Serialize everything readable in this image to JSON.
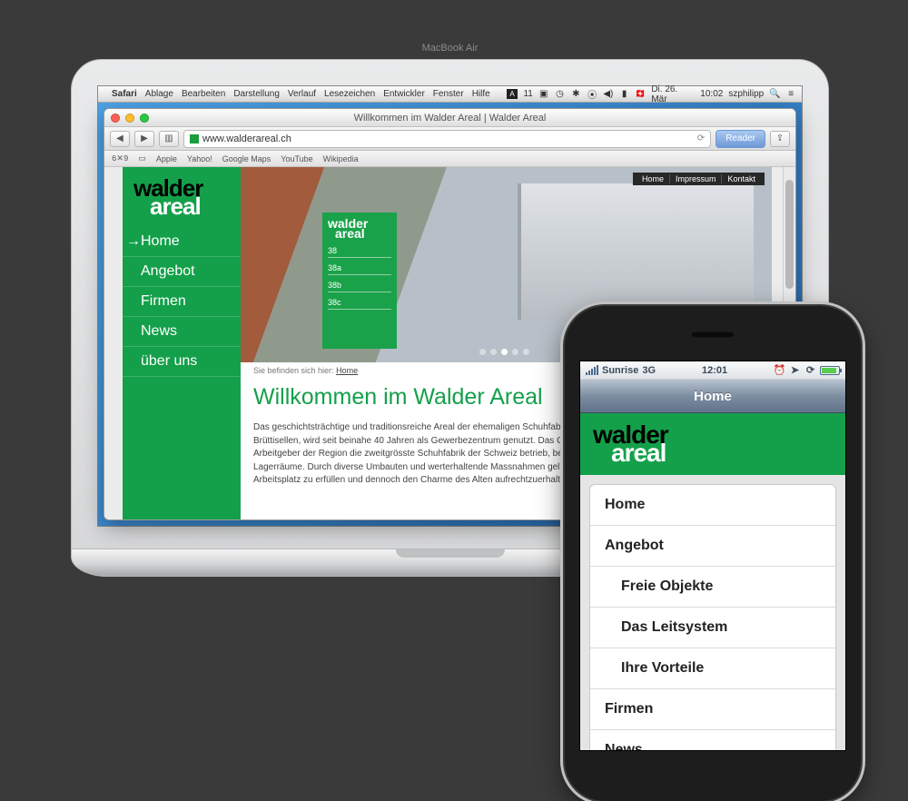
{
  "mac_menubar": {
    "app": "Safari",
    "items": [
      "Ablage",
      "Bearbeiten",
      "Darstellung",
      "Verlauf",
      "Lesezeichen",
      "Entwickler",
      "Fenster",
      "Hilfe"
    ],
    "a_badge": "A",
    "a_count": "11",
    "date": "Di. 26. Mär",
    "time": "10:02",
    "user": "szphilipp"
  },
  "safari": {
    "title": "Willkommen im Walder Areal | Walder Areal",
    "url": "www.walderareal.ch",
    "reader": "Reader",
    "bookmarks_label": "6✕9",
    "bookmarks": [
      "Apple",
      "Yahoo!",
      "Google Maps",
      "YouTube",
      "Wikipedia"
    ]
  },
  "site": {
    "logo1": "walder",
    "logo2": "areal",
    "top_links": [
      "Home",
      "Impressum",
      "Kontakt"
    ],
    "nav": [
      "Home",
      "Angebot",
      "Firmen",
      "News",
      "über uns"
    ],
    "sign_rows": [
      "38",
      "38a",
      "38b",
      "38c"
    ],
    "breadcrumb_prefix": "Sie befinden sich hier:",
    "breadcrumb_link": "Home",
    "heading": "Willkommen im Walder Areal",
    "body": "Das geschichtsträchtige und traditionsreiche Areal der ehemaligen Schuhfabrik Walder, direkt bei der Autobahnausfahrt Brüttisellen, wird seit beinahe 40 Jahren als Gewerbezentrum genutzt. Das Gebiet, auf dem der ehemals wichtigste Arbeitgeber der Region die zweitgrösste Schuhfabrik der Schweiz betrieb, beherbergt heute diverse Büro-, Gewerbe- und Lagerräume. Durch diverse Umbauten und werterhaltende Massnahmen gelingt es, die heutigen Standards an einen Arbeitsplatz zu erfüllen und dennoch den Charme des Alten aufrechtzuerhalten."
  },
  "iphone": {
    "carrier": "Sunrise",
    "net": "3G",
    "time": "12:01",
    "nav_title": "Home",
    "menu": [
      {
        "label": "Home",
        "sub": false
      },
      {
        "label": "Angebot",
        "sub": false
      },
      {
        "label": "Freie Objekte",
        "sub": true
      },
      {
        "label": "Das Leitsystem",
        "sub": true
      },
      {
        "label": "Ihre Vorteile",
        "sub": true
      },
      {
        "label": "Firmen",
        "sub": false
      },
      {
        "label": "News",
        "sub": false
      }
    ]
  }
}
